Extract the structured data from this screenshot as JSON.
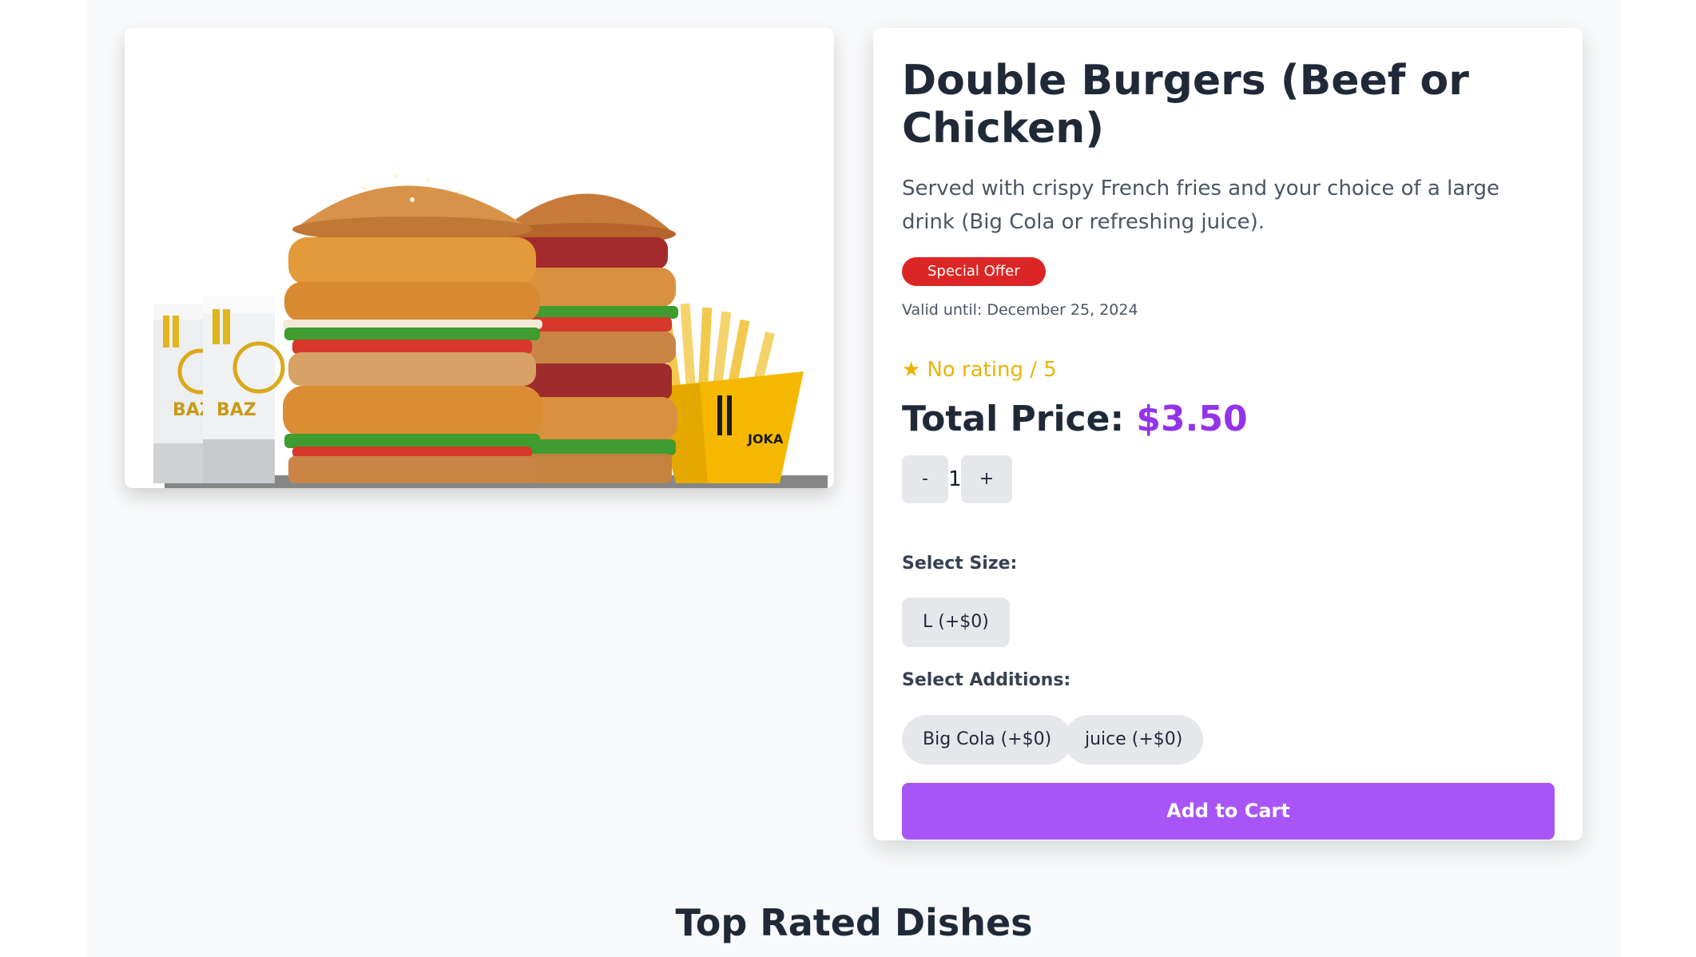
{
  "product": {
    "title": "Double Burgers (Beef or Chicken)",
    "description": "Served with crispy French fries and your choice of a large drink (Big Cola or refreshing juice).",
    "badge": "Special Offer",
    "valid_until": "Valid until: December 25, 2024",
    "rating_icon": "★",
    "rating_text": "No rating / 5",
    "total_label": "Total Price:",
    "total_value": "$3.50",
    "image_alt": "Double burger meal with fries and drinks"
  },
  "quantity": {
    "minus_label": "-",
    "value": "1",
    "plus_label": "+"
  },
  "size": {
    "label": "Select Size:",
    "options": [
      "L (+$0)"
    ]
  },
  "additions": {
    "label": "Select Additions:",
    "options": [
      "Big Cola (+$0)",
      "juice (+$0)"
    ]
  },
  "actions": {
    "add_to_cart": "Add to Cart"
  },
  "sections": {
    "top_rated_heading": "Top Rated Dishes"
  },
  "colors": {
    "accent_purple": "#a855f7",
    "price_purple": "#9333ea",
    "badge_red": "#dc2626",
    "rating_yellow": "#eab308",
    "button_gray": "#e5e7eb"
  }
}
